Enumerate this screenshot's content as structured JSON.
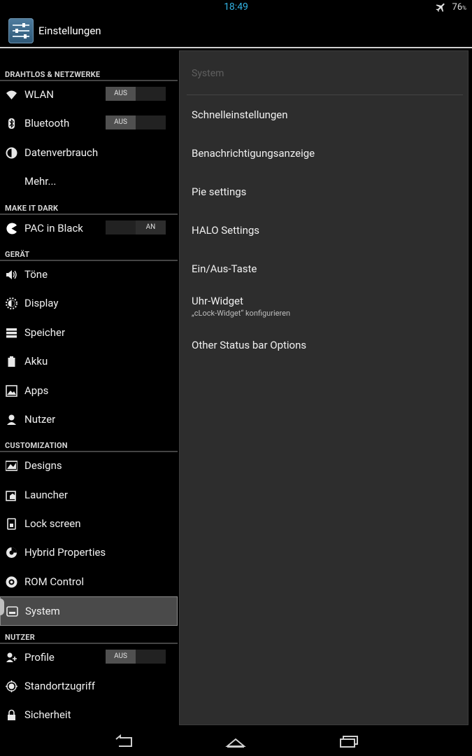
{
  "status_bar": {
    "time": "18:49",
    "battery_value": "76",
    "battery_unit": "%"
  },
  "action_bar": {
    "title": "Einstellungen"
  },
  "left_list": {
    "sections": [
      {
        "header": "DRAHTLOS & NETZWERKE",
        "items": [
          {
            "label": "WLAN",
            "icon": "wifi-icon",
            "switch": "AUS"
          },
          {
            "label": "Bluetooth",
            "icon": "bluetooth-icon",
            "switch": "AUS"
          },
          {
            "label": "Datenverbrauch",
            "icon": "data-usage-icon"
          },
          {
            "label": "Mehr...",
            "icon": ""
          }
        ]
      },
      {
        "header": "MAKE IT DARK",
        "items": [
          {
            "label": "PAC in Black",
            "icon": "pacman-icon",
            "switch": "AN"
          }
        ]
      },
      {
        "header": "GERÄT",
        "items": [
          {
            "label": "Töne",
            "icon": "speaker-icon"
          },
          {
            "label": "Display",
            "icon": "brightness-icon"
          },
          {
            "label": "Speicher",
            "icon": "storage-icon"
          },
          {
            "label": "Akku",
            "icon": "battery-icon"
          },
          {
            "label": "Apps",
            "icon": "apps-icon"
          },
          {
            "label": "Nutzer",
            "icon": "user-icon"
          }
        ]
      },
      {
        "header": "CUSTOMIZATION",
        "items": [
          {
            "label": "Designs",
            "icon": "designs-icon"
          },
          {
            "label": "Launcher",
            "icon": "launcher-icon"
          },
          {
            "label": "Lock screen",
            "icon": "lock-screen-icon"
          },
          {
            "label": "Hybrid Properties",
            "icon": "hybrid-icon"
          },
          {
            "label": "ROM Control",
            "icon": "rom-control-icon"
          },
          {
            "label": "System",
            "icon": "system-icon",
            "selected": true
          }
        ]
      },
      {
        "header": "NUTZER",
        "items": [
          {
            "label": "Profile",
            "icon": "profile-icon",
            "switch": "AUS"
          },
          {
            "label": "Standortzugriff",
            "icon": "location-icon"
          },
          {
            "label": "Sicherheit",
            "icon": "lock-icon"
          }
        ]
      }
    ]
  },
  "right_pane": {
    "header": "System",
    "items": [
      {
        "label": "Schnelleinstellungen"
      },
      {
        "label": "Benachrichtigungsanzeige"
      },
      {
        "label": "Pie settings"
      },
      {
        "label": "HALO Settings"
      },
      {
        "label": "Ein/Aus-Taste"
      },
      {
        "label": "Uhr-Widget",
        "sub": "„cLock-Widget“ konfigurieren"
      },
      {
        "label": "Other Status bar Options"
      }
    ]
  },
  "colors": {
    "accent": "#33b5e5",
    "background": "#000000",
    "pane": "#2d2d2d"
  }
}
